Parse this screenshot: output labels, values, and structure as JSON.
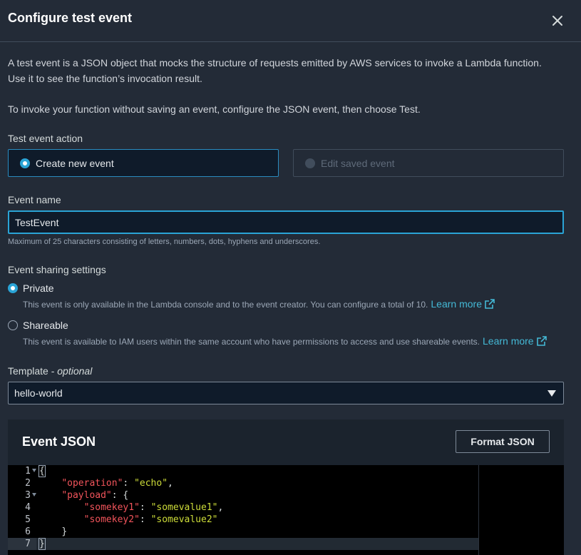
{
  "dialog": {
    "title": "Configure test event",
    "close_icon": "close-icon"
  },
  "intro": {
    "line1": "A test event is a JSON object that mocks the structure of requests emitted by AWS services to invoke a Lambda function.",
    "line2": "Use it to see the function’s invocation result.",
    "line3": "To invoke your function without saving an event, configure the JSON event, then choose Test."
  },
  "test_event_action": {
    "label": "Test event action",
    "options": [
      {
        "label": "Create new event",
        "selected": true
      },
      {
        "label": "Edit saved event",
        "selected": false,
        "disabled": true
      }
    ]
  },
  "event_name": {
    "label": "Event name",
    "value": "TestEvent",
    "hint": "Maximum of 25 characters consisting of letters, numbers, dots, hyphens and underscores."
  },
  "sharing": {
    "label": "Event sharing settings",
    "private": {
      "label": "Private",
      "description": "This event is only available in the Lambda console and to the event creator. You can configure a total of 10.",
      "link": "Learn more",
      "selected": true
    },
    "shareable": {
      "label": "Shareable",
      "description": "This event is available to IAM users within the same account who have permissions to access and use shareable events.",
      "link": "Learn more",
      "selected": false
    }
  },
  "template": {
    "label": "Template",
    "label_suffix": "optional",
    "label_separator": " - ",
    "value": "hello-world"
  },
  "event_json": {
    "title": "Event JSON",
    "format_button": "Format JSON",
    "line_numbers": [
      "1",
      "2",
      "3",
      "4",
      "5",
      "6",
      "7"
    ],
    "code": {
      "l1_open": "{",
      "l2_key": "\"operation\"",
      "l2_sep": ": ",
      "l2_val": "\"echo\"",
      "l2_end": ",",
      "l3_key": "\"payload\"",
      "l3_sep": ": {",
      "l4_key": "\"somekey1\"",
      "l4_sep": ": ",
      "l4_val": "\"somevalue1\"",
      "l4_end": ",",
      "l5_key": "\"somekey2\"",
      "l5_sep": ": ",
      "l5_val": "\"somevalue2\"",
      "l6_close": "}",
      "l7_close": "}"
    }
  },
  "colors": {
    "accent": "#2aa4d6",
    "link": "#44b9d6",
    "json_key": "#f2545b",
    "json_string": "#cddc39"
  }
}
